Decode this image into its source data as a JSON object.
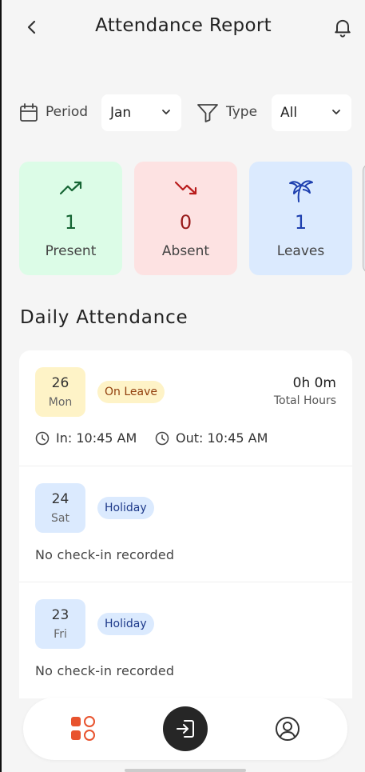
{
  "header": {
    "title": "Attendance Report",
    "back_icon": "chevron-left-icon",
    "bell_icon": "bell-icon"
  },
  "filters": {
    "period_label": "Period",
    "period_value": "Jan",
    "type_label": "Type",
    "type_value": "All"
  },
  "stats": [
    {
      "label": "Present",
      "value": "1",
      "icon": "trending-up-icon",
      "color": "#166534"
    },
    {
      "label": "Absent",
      "value": "0",
      "icon": "trending-down-icon",
      "color": "#b91c1c"
    },
    {
      "label": "Leaves",
      "value": "1",
      "icon": "palm-tree-icon",
      "color": "#1e40af"
    }
  ],
  "section_title": "Daily Attendance",
  "records": [
    {
      "day": "26",
      "weekday": "Mon",
      "status": "On Leave",
      "hours": "0h 0m",
      "hours_label": "Total Hours",
      "in": "In: 10:45 AM",
      "out": "Out: 10:45 AM"
    },
    {
      "day": "24",
      "weekday": "Sat",
      "status": "Holiday",
      "note": "No check-in recorded"
    },
    {
      "day": "23",
      "weekday": "Fri",
      "status": "Holiday",
      "note": "No check-in recorded"
    }
  ],
  "nav": {
    "home_icon": "dashboard-grid-icon",
    "center_icon": "check-in-icon",
    "profile_icon": "user-circle-icon"
  },
  "colors": {
    "accent": "#e8532e",
    "present_bg": "#dcfce7",
    "absent_bg": "#fde2e2",
    "leaves_bg": "#dbeafe"
  }
}
